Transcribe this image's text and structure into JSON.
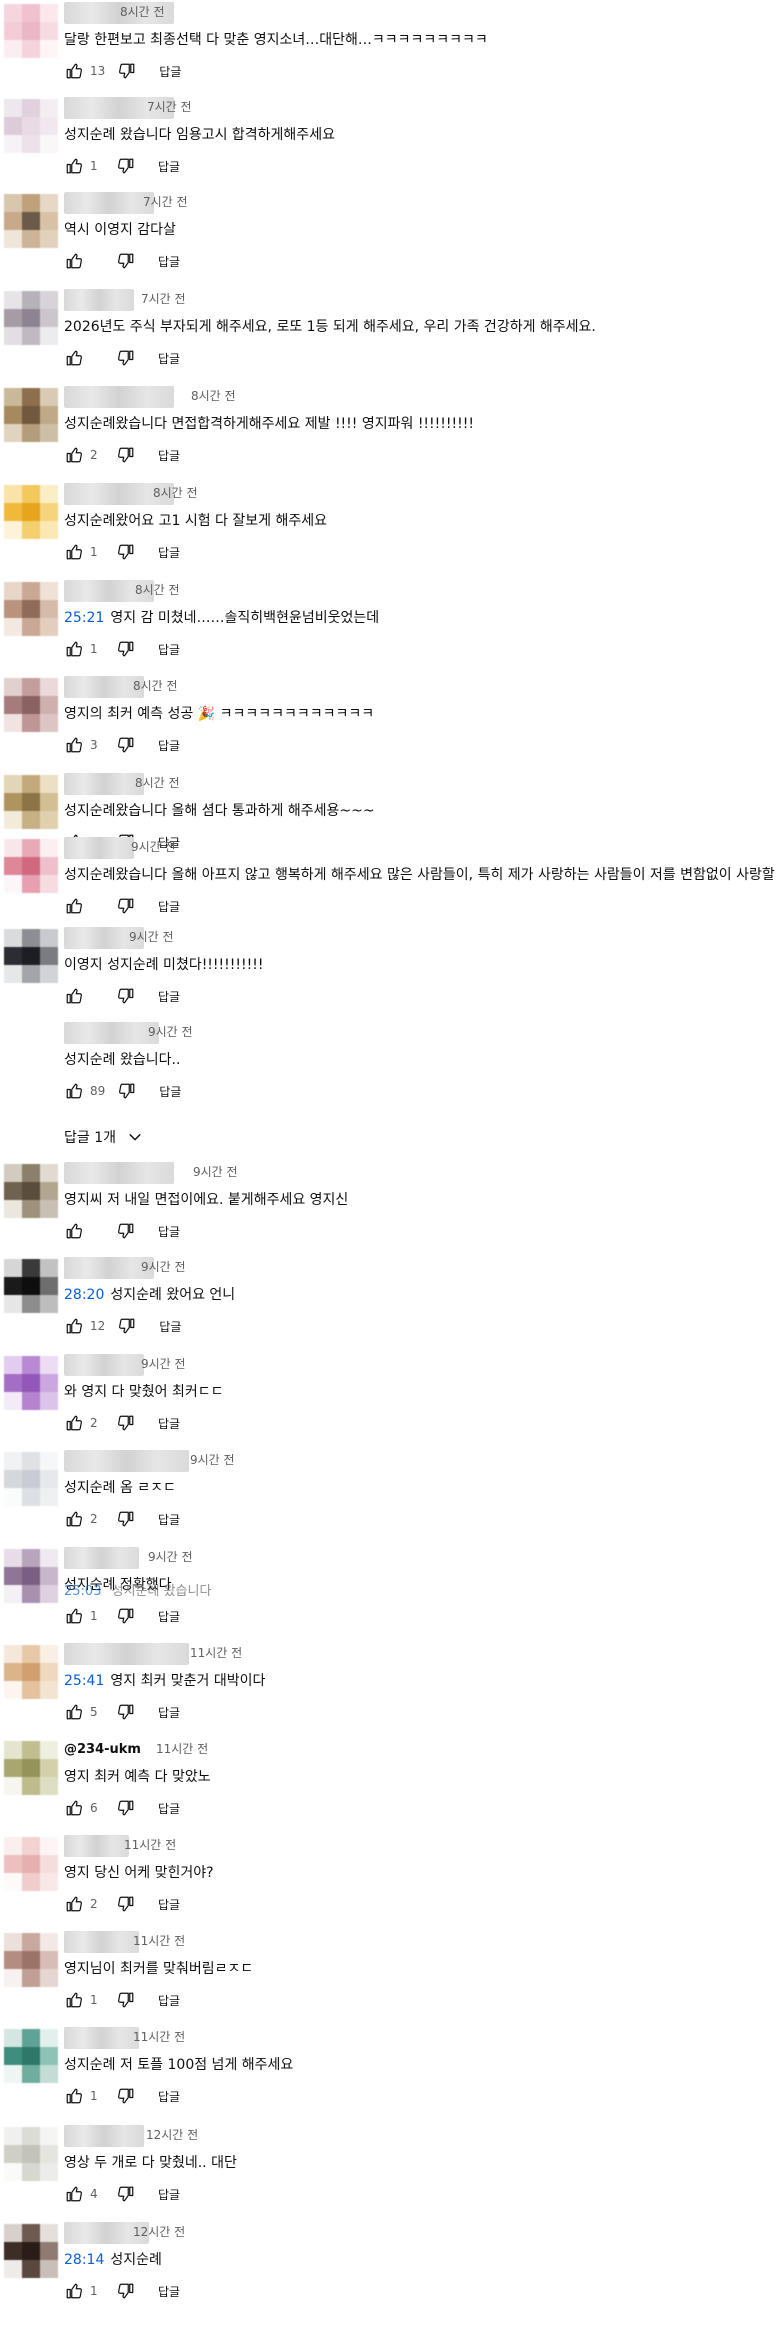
{
  "reply_label": "답글",
  "replies_toggle_label": "답글 1개",
  "overlap_text_timestamp": "25:03",
  "overlap_text_snippet": "성지순례 왔습니다",
  "comments": [
    {
      "time": "8시간 전",
      "text": "달랑 한편보고 최종선택 다 맞춘 영지소녀…대단해…ㅋㅋㅋㅋㅋㅋㅋㅋㅋ",
      "timestamp": "",
      "likes": "13",
      "avatar": [
        "#f6d6de",
        "#f0c2cf",
        "#fbe7ec",
        "#f3ccd8",
        "#e9b7c6",
        "#f7dbe3",
        "#fbeef2",
        "#f4d3dd",
        "#fff5f7"
      ]
    },
    {
      "time": "7시간 전",
      "text": "성지순례 왔습니다 임용고시 합격하게해주세요",
      "timestamp": "",
      "likes": "1",
      "avatar": [
        "#efe7ee",
        "#e1d1de",
        "#f4eef3",
        "#dccbd9",
        "#e8dbe6",
        "#f1e8ef",
        "#f7f2f6",
        "#ece2ea",
        "#faf7f9"
      ]
    },
    {
      "time": "7시간 전",
      "text": "역시 이영지 감다살",
      "timestamp": "",
      "likes": "",
      "avatar": [
        "#d9c7ad",
        "#bfa17c",
        "#e6d8c4",
        "#c8a98a",
        "#6b5a49",
        "#d8c2a5",
        "#efe5d8",
        "#cdb397",
        "#e2d2bd"
      ]
    },
    {
      "time": "7시간 전",
      "text": "2026년도 주식 부자되게 해주세요, 로또 1등 되게 해주세요, 우리 가족 건강하게 해주세요.",
      "timestamp": "",
      "likes": "",
      "avatar": [
        "#e6e4e7",
        "#b7b1b9",
        "#d7d3d8",
        "#a59ca6",
        "#8d848f",
        "#cbc5cc",
        "#e2dee3",
        "#c0b9c2",
        "#ecebed"
      ]
    },
    {
      "time": "8시간 전",
      "text": "성지순례왔습니다 면접합격하게해주세요 제발 !!!! 영지파워 !!!!!!!!!!",
      "timestamp": "",
      "likes": "2",
      "avatar": [
        "#c9b89a",
        "#8e6f4c",
        "#d8cab3",
        "#a7895f",
        "#6f5a3f",
        "#bfa987",
        "#e0d4c0",
        "#b49d7a",
        "#cdbfa7"
      ]
    },
    {
      "time": "8시간 전",
      "text": "성지순례왔어요 고1 시험 다 잘보게 해주세요",
      "timestamp": "",
      "likes": "1",
      "avatar": [
        "#f9e3a8",
        "#f3c95c",
        "#fbeec6",
        "#f0b93a",
        "#e6a51e",
        "#f6d47e",
        "#fdf3d8",
        "#f4cf6d",
        "#fbe8b2"
      ]
    },
    {
      "time": "8시간 전",
      "text": "영지 감 미쳤네……솔직히백현윤넘비웃었는데",
      "timestamp": "25:21",
      "likes": "1",
      "avatar": [
        "#e8d6c8",
        "#c9a995",
        "#efe1d6",
        "#b9937e",
        "#8f6b59",
        "#d7bba9",
        "#f3e9e1",
        "#caa895",
        "#e3cdbd"
      ]
    },
    {
      "time": "8시간 전",
      "text": "영지의 최커 예측 성공 🎉 ㅋㅋㅋㅋㅋㅋㅋㅋㅋㅋㅋㅋ",
      "timestamp": "",
      "likes": "3",
      "avatar": [
        "#e2d0cf",
        "#c49e9d",
        "#ead9d8",
        "#a57c7b",
        "#8a6261",
        "#cfb0af",
        "#f0e3e2",
        "#bf9695",
        "#dcc5c4"
      ]
    },
    {
      "time": "8시간 전",
      "text": "성지순례왔습니다 올해 셤다 통과하게 해주세용~~~",
      "timestamp": "",
      "likes": "",
      "avatar": [
        "#e3d6b8",
        "#c2ab78",
        "#ecdfc6",
        "#b09460",
        "#8c7447",
        "#d3bf94",
        "#f3ebd9",
        "#c7b083",
        "#e0d1ae"
      ]
    },
    {
      "time": "9시간 전",
      "text": "성지순례왔습니다 올해 아프지 않고 행복하게 해주세요 많은 사람들이, 특히 제가 사랑하는 사람들이 저를 변함없이 사랑할",
      "timestamp": "",
      "likes": "",
      "avatar": [
        "#f8e6ea",
        "#e9aab8",
        "#fbeff2",
        "#dd8799",
        "#d2687f",
        "#efc0cb",
        "#fdf6f8",
        "#e6a0b0",
        "#f6dbe1"
      ]
    },
    {
      "time": "9시간 전",
      "text": "이영지 성지순례 미쳤다!!!!!!!!!!!",
      "timestamp": "",
      "likes": "",
      "avatar": [
        "#dadbdd",
        "#8c8e93",
        "#c8cace",
        "#2b2d33",
        "#1c1e24",
        "#7a7c82",
        "#e6e7e9",
        "#a3a5aa",
        "#d2d3d6"
      ]
    },
    {
      "time": "9시간 전",
      "text": "성지순례 왔습니다..",
      "timestamp": "",
      "likes": "89",
      "avatar": [
        "#ffffff",
        "#ffffff",
        "#ffffff",
        "#ffffff",
        "#ffffff",
        "#ffffff",
        "#ffffff",
        "#ffffff",
        "#ffffff"
      ]
    },
    {
      "time": "9시간 전",
      "text": "영지씨 저 내일 면접이에요. 붙게해주세요 영지신",
      "timestamp": "",
      "likes": "",
      "avatar": [
        "#d2cbc0",
        "#8d806b",
        "#e0dad0",
        "#6f624f",
        "#5a4d3b",
        "#b2a690",
        "#ebe6de",
        "#9e927c",
        "#c8c0b3"
      ]
    },
    {
      "time": "9시간 전",
      "text": "성지순례 왔어요 언니",
      "timestamp": "28:20",
      "likes": "12",
      "avatar": [
        "#d6d6d6",
        "#3a3a3a",
        "#c2c2c2",
        "#1a1a1a",
        "#0e0e0e",
        "#6e6e6e",
        "#e6e6e6",
        "#8d8d8d",
        "#bdbdbd"
      ]
    },
    {
      "time": "9시간 전",
      "text": "와 영지 다 맞췄어 최커ㄷㄷ",
      "timestamp": "",
      "likes": "2",
      "avatar": [
        "#e3cdee",
        "#b98ad3",
        "#ecdcf4",
        "#a56ec6",
        "#9257b9",
        "#cba6df",
        "#f4ebf9",
        "#b583d0",
        "#dcc3ea"
      ]
    },
    {
      "time": "9시간 전",
      "text": "성지순례 옴 ㄹㅈㄷ",
      "timestamp": "",
      "likes": "2",
      "avatar": [
        "#f1f2f4",
        "#dfe1e5",
        "#f6f7f8",
        "#d4d7dc",
        "#c9cdd3",
        "#e6e8eb",
        "#fafbfb",
        "#dcdfe3",
        "#eff0f2"
      ]
    },
    {
      "time": "9시간 전",
      "text": "성지순례 정확했다",
      "timestamp": "",
      "likes": "1",
      "avatar": [
        "#e6dde8",
        "#b9a4be",
        "#efe9f1",
        "#8f7596",
        "#7a5f82",
        "#c8b7cc",
        "#f4f0f5",
        "#a891ae",
        "#ded2e1"
      ]
    },
    {
      "time": "11시간 전",
      "text": "영지 최커 맞춘거 대박이다",
      "timestamp": "25:41",
      "likes": "5",
      "avatar": [
        "#f5e8da",
        "#e7c9a7",
        "#f9efe4",
        "#dcb48a",
        "#d29f6e",
        "#eed8bf",
        "#fcf6ef",
        "#e4c29d",
        "#f3e3d1"
      ]
    },
    {
      "time": "11시간 전",
      "text": "영지 최커 예측 다 맞았노",
      "timestamp": "",
      "likes": "6",
      "avatar": [
        "#e5e5cf",
        "#c0bf8f",
        "#efefe0",
        "#a8a76f",
        "#94935a",
        "#d2d1ab",
        "#f6f6ee",
        "#bdbc8a",
        "#dedec3"
      ]
    },
    {
      "time": "11시간 전",
      "text": "영지 당신 어케 맞힌거야?",
      "timestamp": "",
      "likes": "2",
      "avatar": [
        "#fbeeee",
        "#f3d2d2",
        "#fdf5f5",
        "#edc0c0",
        "#e7b0b0",
        "#f6dddd",
        "#fefafa",
        "#f1cccc",
        "#f9e8e8"
      ]
    },
    {
      "time": "11시간 전",
      "text": "영지님이 최커를 맞춰버림ㄹㅈㄷ",
      "timestamp": "",
      "likes": "1",
      "avatar": [
        "#ece0dc",
        "#c9a89f",
        "#f2e9e6",
        "#b38c82",
        "#9c7369",
        "#d8bdb6",
        "#f7f1ef",
        "#c29f96",
        "#e6d6d1"
      ]
    },
    {
      "time": "11시간 전",
      "text": "성지순례 저 토플 100점 넘게 해주세요",
      "timestamp": "",
      "likes": "1",
      "avatar": [
        "#d3e6e1",
        "#5fa395",
        "#e2efec",
        "#3f8d7d",
        "#2e7868",
        "#8ec2b6",
        "#eef6f4",
        "#6fae9f",
        "#c3ddd6"
      ]
    },
    {
      "time": "12시간 전",
      "text": "영상 두 개로 다 맞췄네.. 대단",
      "timestamp": "",
      "likes": "4",
      "avatar": [
        "#f0f0ee",
        "#dcdcd6",
        "#f5f5f3",
        "#cfcfc8",
        "#c3c3bb",
        "#e5e5e0",
        "#fafaf9",
        "#d7d7d1",
        "#ececea"
      ]
    },
    {
      "time": "12시간 전",
      "text": "성지순례",
      "timestamp": "28:14",
      "likes": "1",
      "avatar": [
        "#d8d0cb",
        "#6e5a51",
        "#e5dfdb",
        "#3d2d27",
        "#2a1d18",
        "#8f7b72",
        "#efebe8",
        "#5a4740",
        "#c9beb8"
      ]
    }
  ],
  "named_author": "@234-ukm"
}
